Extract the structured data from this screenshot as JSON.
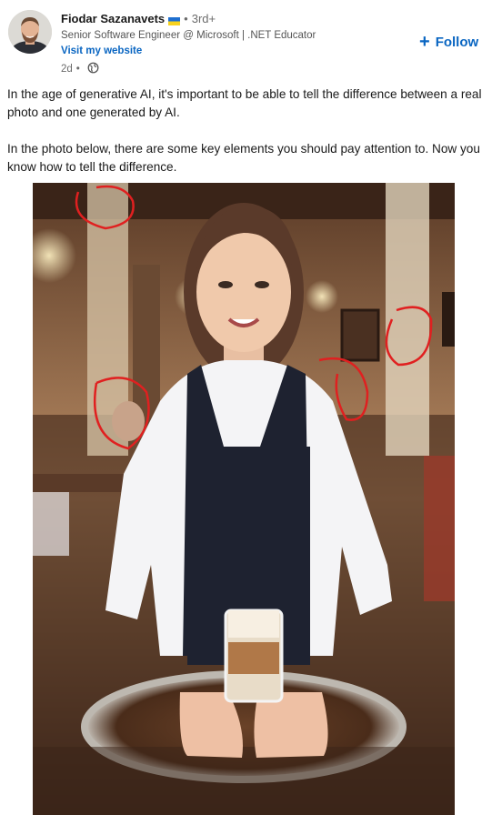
{
  "author": {
    "name": "Fiodar Sazanavets",
    "flag": "ukraine-flag",
    "degree": "3rd+",
    "headline": "Senior Software Engineer @ Microsoft | .NET Educator",
    "website_label": "Visit my website",
    "time": "2d",
    "visibility_icon": "globe-icon"
  },
  "follow": {
    "plus": "+",
    "label": "Follow"
  },
  "post": {
    "paragraphs": [
      "In the age of generative AI, it's important to be able to tell the difference between a real photo and one generated by AI.",
      "In the photo below, there are some key elements you should pay attention to. Now you know how to tell the difference."
    ]
  },
  "image": {
    "subject": "ai-generated-waitress-photo",
    "annotation_color": "#e02020",
    "annotations": [
      "ceiling-circle",
      "left-background-person-circle",
      "shoulder-circle",
      "wall-switch-circle"
    ]
  }
}
